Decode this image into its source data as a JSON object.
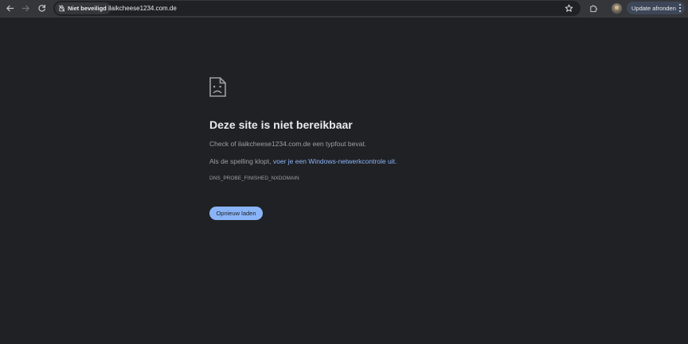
{
  "browser": {
    "security_label": "Niet beveiligd",
    "url": "ilaikcheese1234.com.de",
    "update_label": "Update afronden",
    "icons": {
      "back": "back-arrow-icon",
      "forward": "forward-arrow-icon",
      "reload": "reload-icon",
      "security": "not-secure-icon",
      "bookmark": "star-icon",
      "extensions": "puzzle-icon",
      "profile": "avatar",
      "menu": "vertical-dots-icon"
    }
  },
  "error_page": {
    "icon": "sad-page-icon",
    "title": "Deze site is niet bereikbaar",
    "line1": "Check of ilaikcheese1234.com.de een typfout bevat.",
    "line2_prefix": "Als de spelling klopt, ",
    "line2_link": "voer je een Windows-netwerkcontrole uit",
    "line2_suffix": ".",
    "error_code": "DNS_PROBE_FINISHED_NXDOMAIN",
    "reload_button": "Opnieuw laden"
  },
  "colors": {
    "page_background": "#202124",
    "toolbar_background": "#35363a",
    "link": "#8ab4f8",
    "button": "#8ab4f8"
  }
}
